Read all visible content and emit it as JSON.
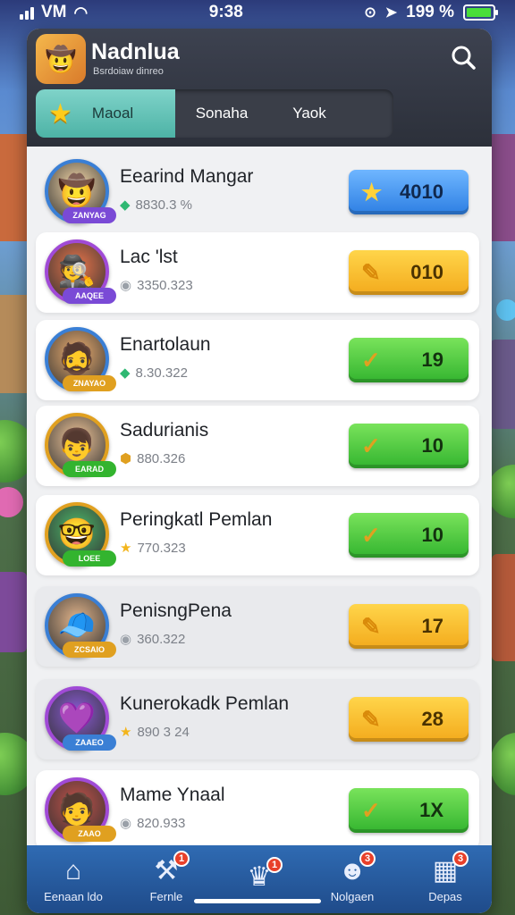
{
  "status_bar": {
    "carrier": "VM",
    "time": "9:38",
    "battery": "199 %",
    "battery_level": 0.95
  },
  "header": {
    "title": "Nadnlua",
    "subtitle": "Bsrdoiaw dinreo"
  },
  "tabs": [
    {
      "label": "Maoal",
      "icon": "star-icon",
      "active": true
    },
    {
      "label": "Sonaha",
      "active": false
    },
    {
      "label": "Yaok",
      "active": false
    }
  ],
  "players": [
    {
      "name": "Eearind Mangar",
      "score": "8830.3 %",
      "button": "4010",
      "button_color": "blue",
      "score_icon": "gem-icon",
      "avatar": "🤠",
      "avatar_badge": "ZANYAG"
    },
    {
      "name": "Lac 'lst",
      "score": "3350.323",
      "button": "010",
      "button_color": "yellow",
      "score_icon": "badge-icon",
      "avatar": "🕵",
      "avatar_badge": "AAQEE"
    },
    {
      "name": "Enartolaun",
      "score": "8.30.322",
      "button": "19",
      "button_color": "green",
      "score_icon": "gem-icon",
      "avatar": "🧔",
      "avatar_badge": "ZNAYAO"
    },
    {
      "name": "Sadurianis",
      "score": "880.326",
      "button": "10",
      "button_color": "green",
      "score_icon": "coin-icon",
      "avatar": "👦",
      "avatar_badge": "EARAD"
    },
    {
      "name": "Peringkatl Pemlan",
      "score": "770.323",
      "button": "10",
      "button_color": "green",
      "score_icon": "star-icon",
      "avatar": "🤓",
      "avatar_badge": "LOEE"
    },
    {
      "name": "PenisngPena",
      "score": "360.322",
      "button": "17",
      "button_color": "yellow",
      "score_icon": "badge-icon",
      "avatar": "🧢",
      "avatar_badge": "ZCSAIO"
    },
    {
      "name": "Kunerokadk Pemlan",
      "score": "890 3 24",
      "button": "28",
      "button_color": "yellow",
      "score_icon": "star-icon",
      "avatar": "💜",
      "avatar_badge": "ZAAEO"
    },
    {
      "name": "Mame Ynaal",
      "score": "820.933",
      "button": "1X",
      "button_color": "green",
      "score_icon": "badge-icon",
      "avatar": "🧑",
      "avatar_badge": "ZAAO"
    }
  ],
  "bottom_nav": [
    {
      "label": "Eenaan ldo",
      "icon": "house-icon",
      "badge": ""
    },
    {
      "label": "Fernle",
      "icon": "hammer-icon",
      "badge": "1"
    },
    {
      "label": "",
      "icon": "crown-icon",
      "badge": "1"
    },
    {
      "label": "Nolgaen",
      "icon": "team-icon",
      "badge": "3"
    },
    {
      "label": "Depas",
      "icon": "map-icon",
      "badge": "3"
    }
  ],
  "colors": {
    "accent": "#4db3a6",
    "button_blue": "#2d7fe3",
    "button_yellow": "#f3aa1c",
    "button_green": "#33b42f",
    "nav_bg": "#1f4b8a"
  }
}
